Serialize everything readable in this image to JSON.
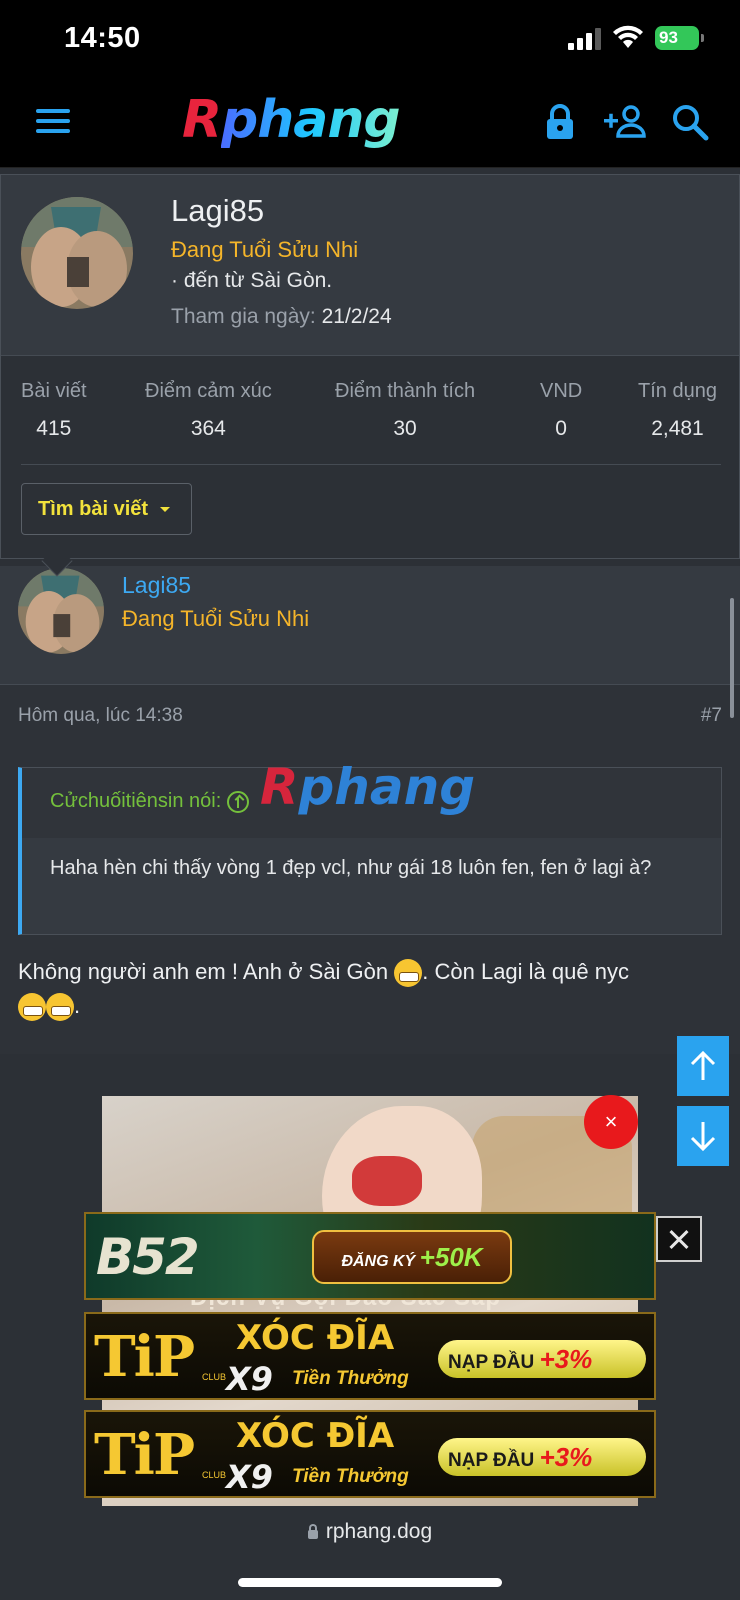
{
  "status_bar": {
    "time": "14:50",
    "battery": "93"
  },
  "header": {
    "logo_part1": "R",
    "logo_part2": "phang",
    "icons": [
      "menu-icon",
      "lock-icon",
      "add-user-icon",
      "search-icon"
    ]
  },
  "popup": {
    "username": "Lagi85",
    "user_title": "Đang Tuổi Sửu Nhi",
    "location": "· đến từ Sài Gòn.",
    "join_label": "Tham gia ngày:",
    "join_date": "21/2/24",
    "stats": [
      {
        "label": "Bài viết",
        "value": "415"
      },
      {
        "label": "Điểm cảm xúc",
        "value": "364"
      },
      {
        "label": "Điểm thành tích",
        "value": "30"
      },
      {
        "label": "VND",
        "value": "0"
      },
      {
        "label": "Tín dụng",
        "value": "2,481"
      }
    ],
    "find_posts_label": "Tìm bài viết"
  },
  "user_card": {
    "username": "Lagi85",
    "user_title": "Đang Tuổi Sửu Nhi"
  },
  "post": {
    "date": "Hôm qua, lúc 14:38",
    "number": "#7",
    "quote_author": "Cửchuốitiênsin nói:",
    "quote_text": "Haha hèn chi thấy vòng 1 đẹp vcl, như gái 18 luôn fen, fen ở lagi à?",
    "text_part1": "Không người anh em ! Anh ở Sài Gòn ",
    "text_part2": ". Còn Lagi là quê nyc "
  },
  "watermark": {
    "part1": "R",
    "part2": "phang"
  },
  "ads": {
    "close_x": "×",
    "caption": "Dịch Vụ Gọi Đào Sắc Sắp",
    "b52_logo": "B52",
    "b52_cta": "ĐĂNG KÝ",
    "b52_bonus": "+50K",
    "tip_logo": "TiP",
    "tip_club": "CLUB",
    "tip_line1": "XÓC ĐĨA",
    "tip_line2": "X9",
    "tip_line3": "Tiền Thưởng",
    "tip_cta": "NẠP ĐẦU",
    "tip_bonus": "+3%"
  },
  "bottom_bar": {
    "url": "rphang.dog"
  },
  "colors": {
    "accent_blue": "#3da9f2",
    "title_gold": "#f5b52a",
    "quote_green": "#74c03c",
    "button_yellow": "#f2e23c"
  }
}
